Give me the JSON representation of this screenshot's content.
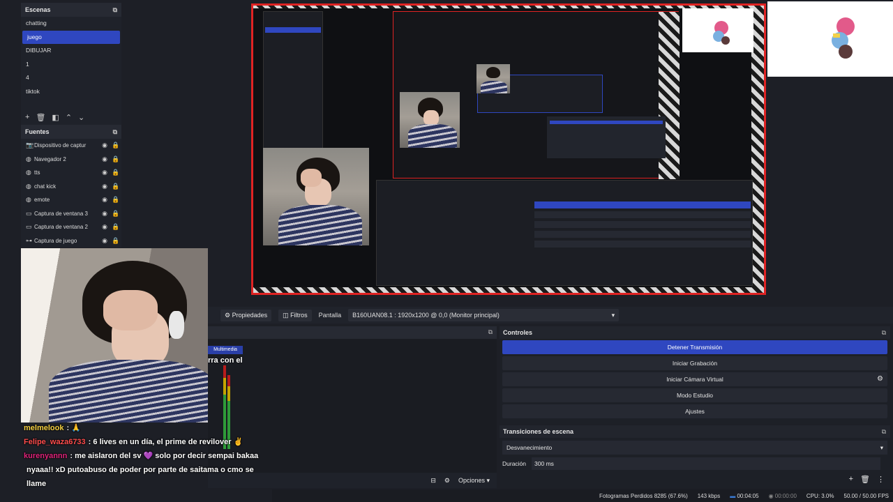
{
  "scenes": {
    "title": "Escenas",
    "items": [
      "chatting",
      "juego",
      "DIBUJAR",
      "1",
      "4",
      "tiktok"
    ],
    "selected_index": 1
  },
  "sources": {
    "title": "Fuentes",
    "items": [
      {
        "label": "Dispositivo de captur",
        "icon": "camera-icon"
      },
      {
        "label": "Navegador 2",
        "icon": "globe-icon"
      },
      {
        "label": "tts",
        "icon": "globe-icon"
      },
      {
        "label": "chat kick",
        "icon": "globe-icon"
      },
      {
        "label": "emote",
        "icon": "globe-icon"
      },
      {
        "label": "Captura de ventana 3",
        "icon": "window-icon"
      },
      {
        "label": "Captura de ventana 2",
        "icon": "window-icon"
      },
      {
        "label": "Captura de juego",
        "icon": "gamepad-icon"
      }
    ]
  },
  "props_bar": {
    "properties": "Propiedades",
    "filters": "Filtros",
    "screen_label": "Pantalla",
    "screen_value": "B160UAN08.1 : 1920x1200 @ 0,0 (Monitor principal)"
  },
  "mixer": {
    "badge": "Multimedia",
    "options": "Opciones"
  },
  "controls": {
    "title": "Controles",
    "stop_stream": "Detener Transmisión",
    "start_recording": "Iniciar Grabación",
    "start_virtual_cam": "Iniciar Cámara Virtual",
    "studio_mode": "Modo Estudio",
    "settings": "Ajustes"
  },
  "transitions": {
    "title": "Transiciones de escena",
    "selected": "Desvanecimiento",
    "duration_label": "Duración",
    "duration_value": "300 ms"
  },
  "status": {
    "dropped_frames": "Fotogramas Perdidos 8285 (67.6%)",
    "bitrate": "143 kbps",
    "stream_time": "00:04:05",
    "record_time": "00:00:00",
    "cpu": "CPU: 3.0%",
    "fps": "50.00 / 50.00 FPS"
  },
  "chat": [
    {
      "user": "melmelook",
      "user_color": "#f5d041",
      "text": ": 🙏"
    },
    {
      "user": "Felipe_waza6733",
      "user_color": "#ff4d4d",
      "text": ": 6 lives en un día, el prime de revilover ✌️"
    },
    {
      "user": "kurenyannn",
      "user_color": "#e0237a",
      "text": ": me aislaron del sv 💜 solo por decir sempai bakaa"
    },
    {
      "user": "",
      "user_color": "#ffffff",
      "text": "nyaaa!! xD putoabuso de poder por parte de saitama o cmo se"
    },
    {
      "user": "",
      "user_color": "#ffffff",
      "text": "llame"
    }
  ],
  "chat_overflow": "rra con el",
  "colors": {
    "accent": "#2f47c0",
    "preview_border": "#e02323",
    "bg": "#1d1f26"
  }
}
